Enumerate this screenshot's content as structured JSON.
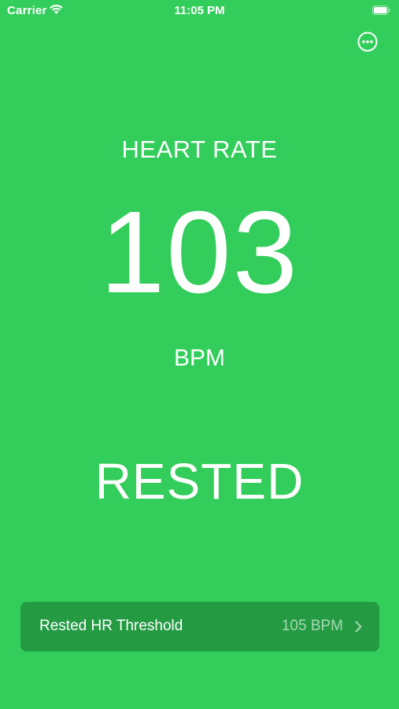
{
  "status_bar": {
    "carrier": "Carrier",
    "time": "11:05 PM",
    "wifi_icon": "wifi-icon",
    "battery_icon": "battery-icon"
  },
  "toolbar": {
    "more_icon": "ellipsis-circle-icon"
  },
  "readout": {
    "heading": "HEART RATE",
    "value": "103",
    "unit": "BPM",
    "status": "RESTED"
  },
  "threshold": {
    "label": "Rested HR Threshold",
    "value": "105 BPM",
    "chevron_icon": "chevron-right-icon"
  },
  "colors": {
    "background": "#32cd5a",
    "row_background": "#249a43",
    "text": "#ffffff",
    "secondary_text": "#a6d9b2"
  }
}
